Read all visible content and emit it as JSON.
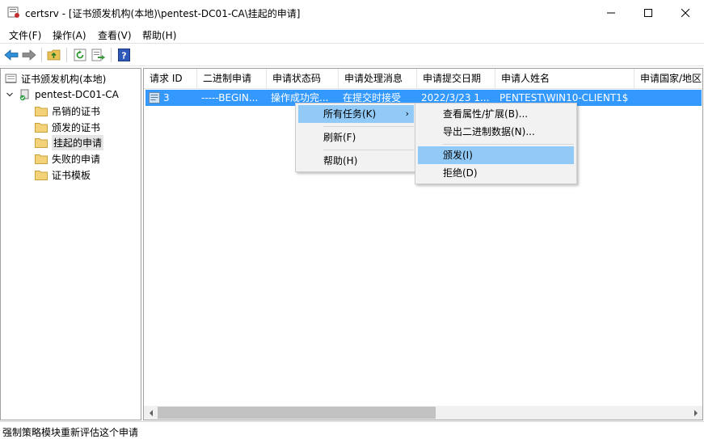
{
  "window": {
    "title": "certsrv - [证书颁发机构(本地)\\pentest-DC01-CA\\挂起的申请]"
  },
  "menubar": {
    "items": [
      "文件(F)",
      "操作(A)",
      "查看(V)",
      "帮助(H)"
    ]
  },
  "toolbar": {
    "icons": [
      "back-icon",
      "forward-icon",
      "up-folder-icon",
      "refresh-icon",
      "export-list-icon",
      "help-icon"
    ]
  },
  "tree": {
    "root": "证书颁发机构(本地)",
    "ca": "pentest-DC01-CA",
    "children": [
      "吊销的证书",
      "颁发的证书",
      "挂起的申请",
      "失败的申请",
      "证书模板"
    ],
    "selected": "挂起的申请"
  },
  "list": {
    "columns": [
      "请求 ID",
      "二进制申请",
      "申请状态码",
      "申请处理消息",
      "申请提交日期",
      "申请人姓名",
      "申请国家/地区"
    ],
    "rows": [
      {
        "id": "3",
        "binary": "-----BEGIN...",
        "status_code": "操作成功完...",
        "message": "在提交时接受",
        "date": "2022/3/23 1...",
        "requester": "PENTEST\\WIN10-CLIENT1$",
        "country": ""
      }
    ]
  },
  "context_menu": {
    "items": [
      "所有任务(K)",
      "刷新(F)",
      "帮助(H)"
    ]
  },
  "submenu": {
    "items": [
      "查看属性/扩展(B)...",
      "导出二进制数据(N)...",
      "颁发(I)",
      "拒绝(D)"
    ],
    "highlighted": "颁发(I)"
  },
  "statusbar": {
    "text": "强制策略模块重新评估这个申请"
  },
  "colors": {
    "selection": "#3399ff",
    "menu_highlight": "#91c9f7",
    "folder": "#f4d27a"
  }
}
